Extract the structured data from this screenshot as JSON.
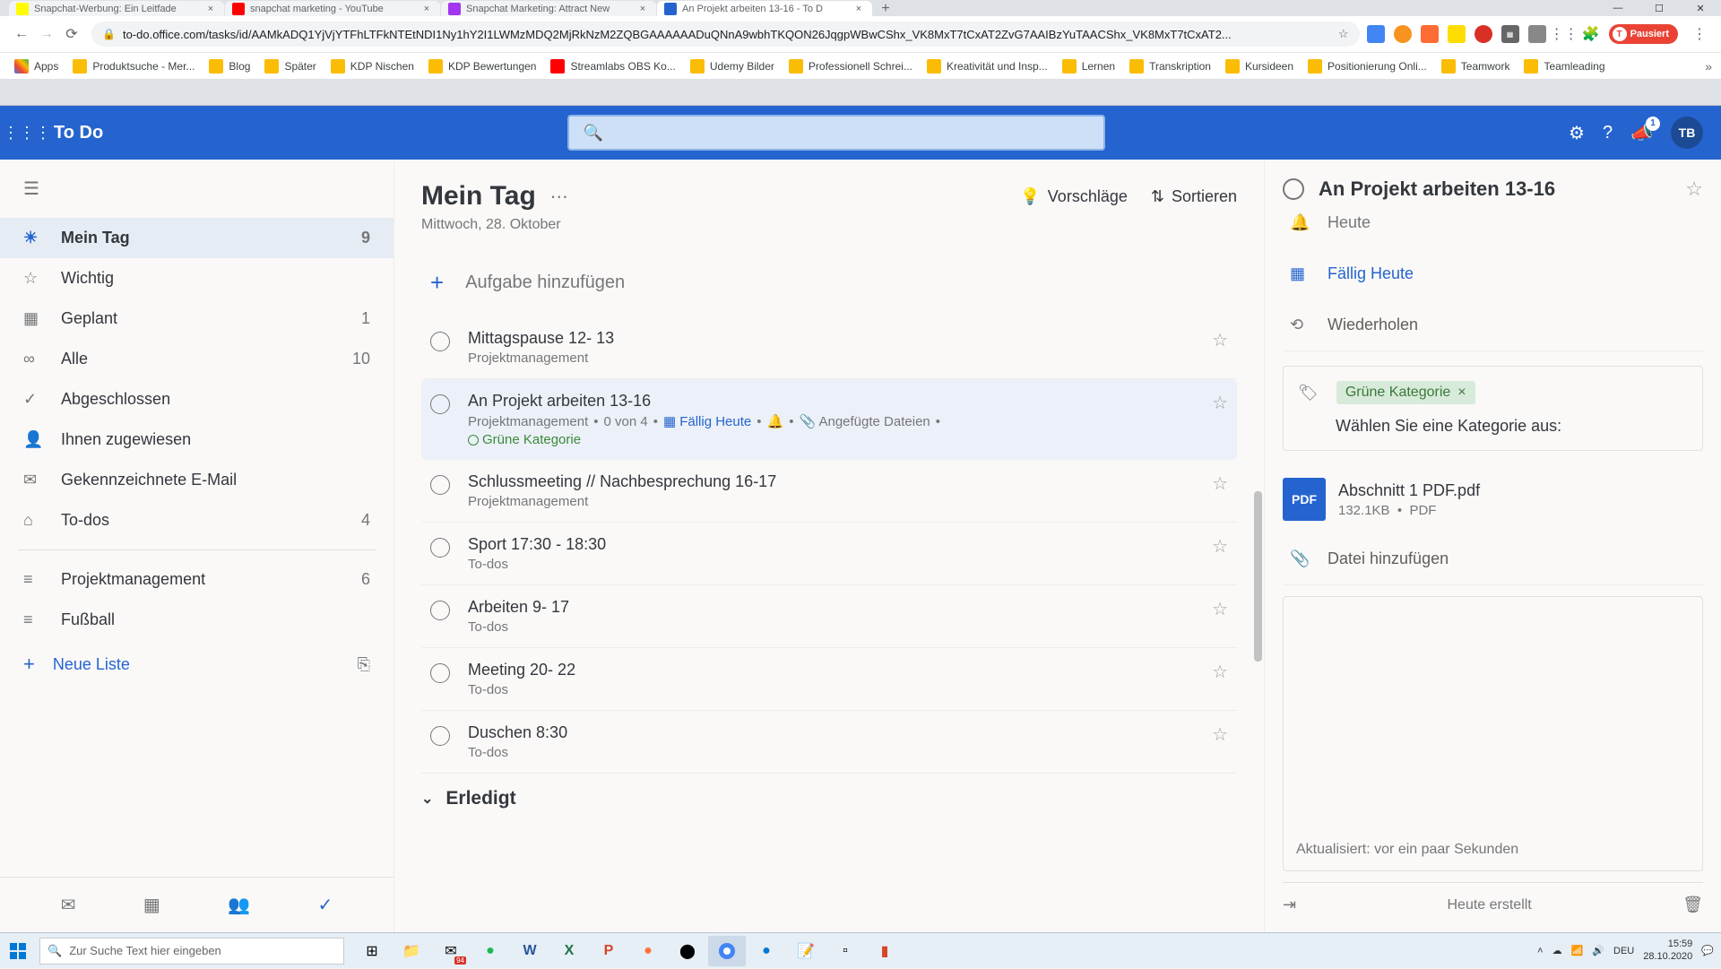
{
  "browser": {
    "tabs": [
      {
        "title": "Snapchat-Werbung: Ein Leitfade",
        "favicon": "#FFFC00"
      },
      {
        "title": "snapchat marketing - YouTube",
        "favicon": "#FF0000"
      },
      {
        "title": "Snapchat Marketing: Attract New",
        "favicon": "#a435f0"
      },
      {
        "title": "An Projekt arbeiten 13-16 - To D",
        "favicon": "#2564cf",
        "active": true
      }
    ],
    "url": "to-do.office.com/tasks/id/AAMkADQ1YjVjYTFhLTFkNTEtNDI1Ny1hY2I1LWMzMDQ2MjRkNzM2ZQBGAAAAAADuQNnA9wbhTKQON26JqgpWBwCShx_VK8MxT7tCxAT2ZvG7AAIBzYuTAACShx_VK8MxT7tCxAT2...",
    "user_badge": "Pausiert",
    "bookmarks": [
      "Apps",
      "Produktsuche - Mer...",
      "Blog",
      "Später",
      "KDP Nischen",
      "KDP Bewertungen",
      "Streamlabs OBS Ko...",
      "Udemy Bilder",
      "Professionell Schrei...",
      "Kreativität und Insp...",
      "Lernen",
      "Transkription",
      "Kursideen",
      "Positionierung Onli...",
      "Teamwork",
      "Teamleading"
    ]
  },
  "app": {
    "title": "To Do",
    "notif_count": "1",
    "avatar": "TB"
  },
  "sidebar": {
    "items": [
      {
        "icon": "☀",
        "label": "Mein Tag",
        "count": "9",
        "active": true
      },
      {
        "icon": "☆",
        "label": "Wichtig"
      },
      {
        "icon": "▦",
        "label": "Geplant",
        "count": "1"
      },
      {
        "icon": "∞",
        "label": "Alle",
        "count": "10"
      },
      {
        "icon": "✓",
        "label": "Abgeschlossen"
      },
      {
        "icon": "👤",
        "label": "Ihnen zugewiesen"
      },
      {
        "icon": "✉",
        "label": "Gekennzeichnete E-Mail"
      },
      {
        "icon": "⌂",
        "label": "To-dos",
        "count": "4"
      }
    ],
    "lists": [
      {
        "icon": "≡",
        "label": "Projektmanagement",
        "count": "6"
      },
      {
        "icon": "≡",
        "label": "Fußball"
      }
    ],
    "new_list": "Neue Liste"
  },
  "main": {
    "title": "Mein Tag",
    "date": "Mittwoch, 28. Oktober",
    "suggest": "Vorschläge",
    "sort": "Sortieren",
    "add_task": "Aufgabe hinzufügen",
    "tasks": [
      {
        "title": "Mittagspause 12- 13",
        "meta": "Projektmanagement"
      },
      {
        "title": "An Projekt arbeiten 13-16",
        "meta": "Projektmanagement",
        "steps": "0 von 4",
        "due": "Fällig Heute",
        "attach": "Angefügte Dateien",
        "cat": "Grüne Kategorie",
        "bell": true,
        "selected": true
      },
      {
        "title": "Schlussmeeting // Nachbesprechung 16-17",
        "meta": "Projektmanagement"
      },
      {
        "title": "Sport 17:30 - 18:30",
        "meta": "To-dos"
      },
      {
        "title": "Arbeiten 9- 17",
        "meta": "To-dos"
      },
      {
        "title": "Meeting 20- 22",
        "meta": "To-dos"
      },
      {
        "title": "Duschen 8:30",
        "meta": "To-dos"
      }
    ],
    "done": "Erledigt"
  },
  "details": {
    "title": "An Projekt arbeiten 13-16",
    "today": "Heute",
    "due": "Fällig Heute",
    "repeat": "Wiederholen",
    "category": "Grüne Kategorie",
    "category_prompt": "Wählen Sie eine Kategorie aus:",
    "file_name": "Abschnitt 1 PDF.pdf",
    "file_size": "132.1KB",
    "file_type": "PDF",
    "add_file": "Datei hinzufügen",
    "updated": "Aktualisiert: vor ein paar Sekunden",
    "created": "Heute erstellt"
  },
  "taskbar": {
    "search": "Zur Suche Text hier eingeben",
    "lang": "DEU",
    "time": "15:59",
    "date": "28.10.2020"
  }
}
